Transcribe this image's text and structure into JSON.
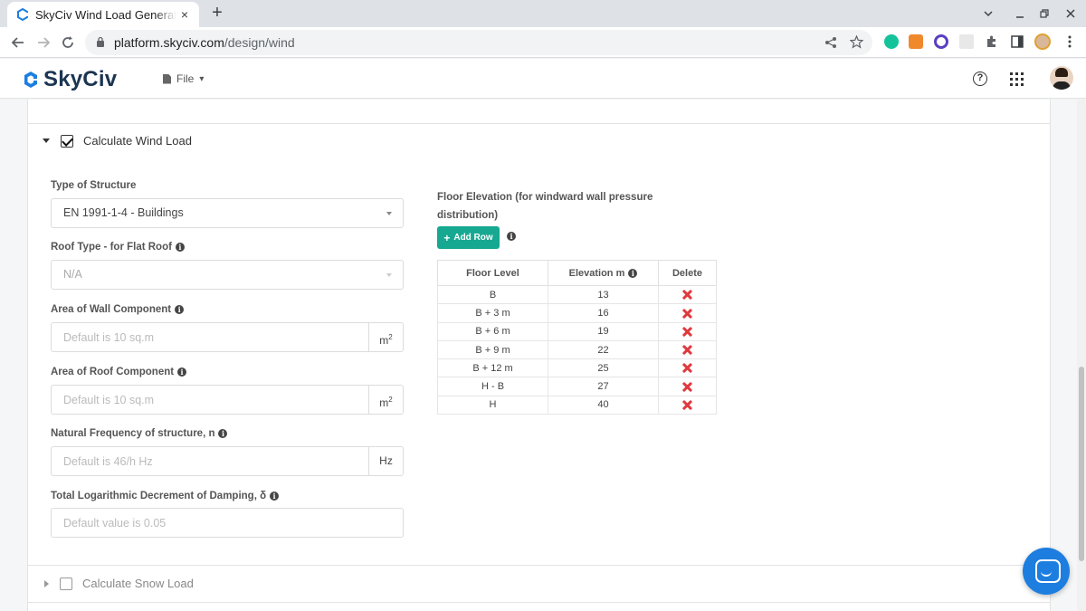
{
  "browser": {
    "tab_title": "SkyCiv Wind Load Generator",
    "tab_close": "×",
    "new_tab": "+",
    "url_host": "platform.skyciv.com",
    "url_path": "/design/wind"
  },
  "app": {
    "logo_text": "SkyCiv",
    "file_menu": "File"
  },
  "wind_section": {
    "title": "Calculate Wind Load",
    "checked": true,
    "structure_type": {
      "label": "Type of Structure",
      "value": "EN 1991-1-4 - Buildings"
    },
    "roof_type": {
      "label": "Roof Type - for Flat Roof",
      "value": "N/A"
    },
    "wall_area": {
      "label": "Area of Wall Component",
      "placeholder": "Default is 10 sq.m",
      "unit": "m",
      "unit_sup": "2"
    },
    "roof_area": {
      "label": "Area of Roof Component",
      "placeholder": "Default is 10 sq.m",
      "unit": "m",
      "unit_sup": "2"
    },
    "frequency": {
      "label": "Natural Frequency of structure, n",
      "placeholder": "Default is 46/h Hz",
      "unit": "Hz"
    },
    "damping": {
      "label": "Total Logarithmic Decrement of Damping, δ",
      "placeholder": "Default value is 0.05"
    },
    "floor_elevation": {
      "label": "Floor Elevation (for windward wall pressure distribution)",
      "add_row_label": "Add Row",
      "columns": [
        "Floor Level",
        "Elevation m",
        "Delete"
      ],
      "rows": [
        {
          "level": "B",
          "elevation": "13"
        },
        {
          "level": "B + 3 m",
          "elevation": "16"
        },
        {
          "level": "B + 6 m",
          "elevation": "19"
        },
        {
          "level": "B + 9 m",
          "elevation": "22"
        },
        {
          "level": "B + 12 m",
          "elevation": "25"
        },
        {
          "level": "H - B",
          "elevation": "27"
        },
        {
          "level": "H",
          "elevation": "40"
        }
      ]
    }
  },
  "snow_section": {
    "title": "Calculate Snow Load",
    "checked": false
  },
  "colors": {
    "accent": "#17a891",
    "delete": "#e0393e",
    "brand": "#1b3552",
    "chat": "#1d7ee0"
  }
}
